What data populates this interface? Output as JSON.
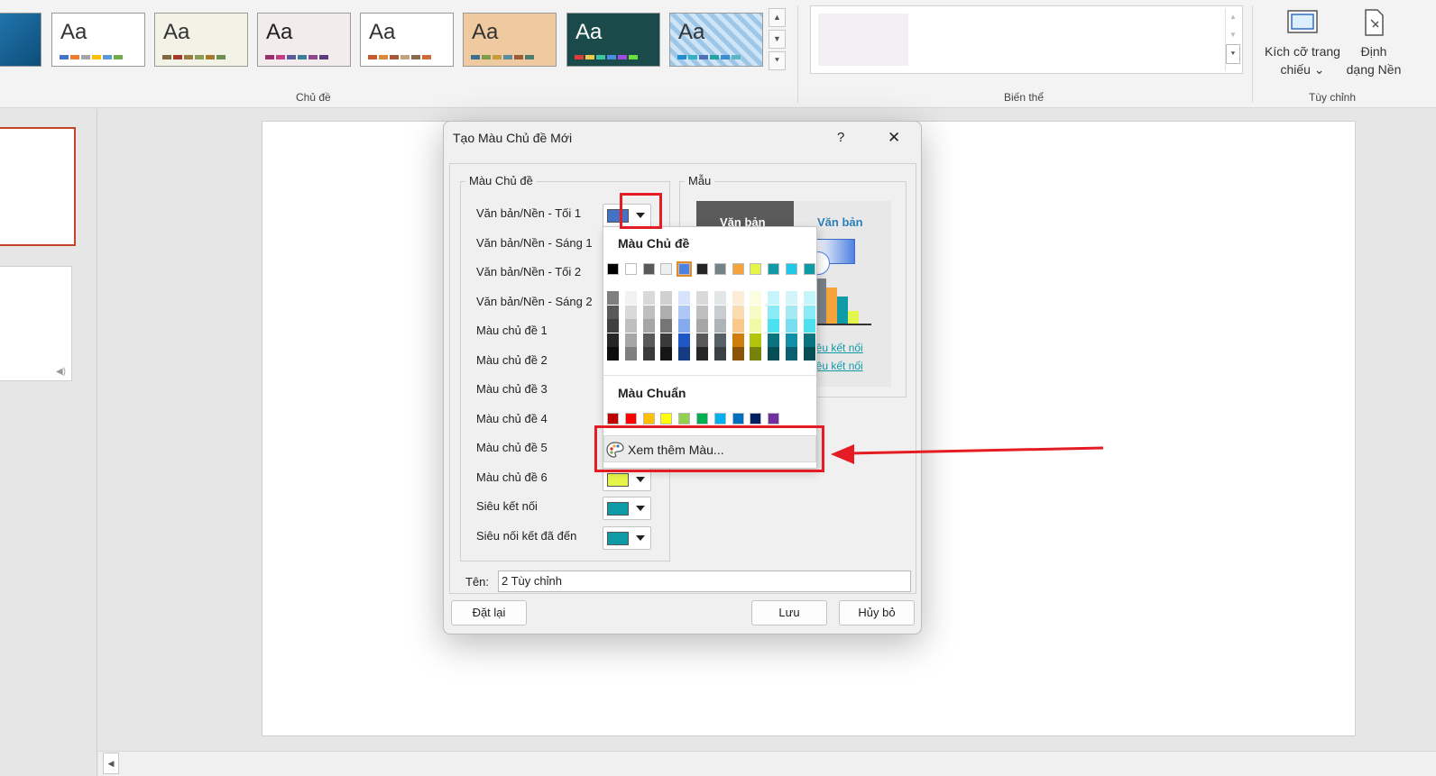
{
  "ribbon": {
    "groups": {
      "themes": "Chủ đề",
      "variants": "Biến thể",
      "customize": "Tùy chỉnh"
    },
    "themes": [
      {
        "aa": "",
        "bg": "#1f6fa3",
        "aa_color": "#fff",
        "bars": []
      },
      {
        "aa": "Aa",
        "bg": "#ffffff",
        "aa_color": "#333333",
        "bars": [
          "#4472c4",
          "#ed7d31",
          "#a5a5a5",
          "#ffc000",
          "#5b9bd5",
          "#70ad47"
        ]
      },
      {
        "aa": "Aa",
        "bg": "#f2f3e6",
        "aa_color": "#333333",
        "bars": [
          "#7f6a3e",
          "#a33a2b",
          "#9b7b3d",
          "#8a9b55",
          "#a67a2d",
          "#6a8f4f"
        ]
      },
      {
        "aa": "Aa",
        "bg": "#f3ecec",
        "aa_color": "#222222",
        "bars": [
          "#9b2f6e",
          "#c43c83",
          "#5a5a9c",
          "#3c7c9c",
          "#8c4a8c",
          "#5c3c7c"
        ]
      },
      {
        "aa": "Aa",
        "bg": "#ffffff",
        "aa_color": "#333333",
        "bars": [
          "#c55a2b",
          "#d98a3a",
          "#a8553c",
          "#c4a27a",
          "#8a6a4a",
          "#d06a3a"
        ]
      },
      {
        "aa": "Aa",
        "bg": "#efc9a0",
        "aa_color": "#333333",
        "bars": [
          "#3c6e8f",
          "#7c9c4c",
          "#c49c3c",
          "#5c8ca0",
          "#9c5c3c",
          "#4c7c6c"
        ]
      },
      {
        "aa": "Aa",
        "bg": "#1b4a4a",
        "aa_color": "#ffffff",
        "bars": [
          "#e03c3c",
          "#ecc94b",
          "#3cc4a0",
          "#4b8ce0",
          "#a04be0",
          "#6ae03c"
        ]
      },
      {
        "aa": "Aa",
        "bg": "#dfe9f3",
        "aa_color": "#333333",
        "bars": [
          "#1f8fcf",
          "#35b0c4",
          "#4c6fb8",
          "#22a4a0",
          "#3c8cd0",
          "#5cb4c4"
        ]
      }
    ],
    "slide_size": {
      "line1": "Kích cỡ trang",
      "line2": "chiếu ⌄",
      "icon": "slide-size-icon"
    },
    "format_bg": {
      "line1": "Định",
      "line2": "dạng Nền",
      "icon": "format-background-icon"
    }
  },
  "dialog": {
    "title": "Tạo Màu Chủ đề Mới",
    "help": "?",
    "close": "✕",
    "theme_colors_group": "Màu Chủ đề",
    "sample_group": "Mẫu",
    "rows": [
      {
        "label": "Văn bản/Nền - Tối 1",
        "color": "#4472c4"
      },
      {
        "label": "Văn bản/Nền - Sáng 1",
        "color": ""
      },
      {
        "label": "Văn bản/Nền - Tối 2",
        "color": ""
      },
      {
        "label": "Văn bản/Nền - Sáng 2",
        "color": ""
      },
      {
        "label": "Màu chủ đề 1",
        "color": ""
      },
      {
        "label": "Màu chủ đề 2",
        "color": ""
      },
      {
        "label": "Màu chủ đề 3",
        "color": ""
      },
      {
        "label": "Màu chủ đề 4",
        "color": ""
      },
      {
        "label": "Màu chủ đề 5",
        "color": ""
      },
      {
        "label": "Màu chủ đề 6",
        "color": "#e6f54a"
      },
      {
        "label": "Siêu kết nối",
        "color": "#0f9aa8"
      },
      {
        "label": "Siêu nối kết đã đến",
        "color": "#0f9aa8"
      }
    ],
    "sample": {
      "dark_text": "Văn bản",
      "light_text": "Văn bản",
      "link1": "Siêu kết nối",
      "link2": "Siêu kết nối"
    },
    "name_label": "Tên:",
    "name_value": "2 Tùy chỉnh",
    "reset": "Đặt lại",
    "save": "Lưu",
    "cancel": "Hủy bỏ"
  },
  "color_popup": {
    "theme_heading": "Màu Chủ đề",
    "theme_colors": [
      "#000000",
      "#ffffff",
      "#595959",
      "#eeeeee",
      "#4f81e0",
      "#252525",
      "#778288",
      "#f5a43c",
      "#e6f54a",
      "#0f9aa8",
      "#1ec8e6",
      "#0f9aa8"
    ],
    "shades": [
      [
        "#7f7f7f",
        "#595959",
        "#404040",
        "#262626",
        "#0d0d0d"
      ],
      [
        "#f2f2f2",
        "#d9d9d9",
        "#bfbfbf",
        "#a6a6a6",
        "#7f7f7f"
      ],
      [
        "#d9d9d9",
        "#bfbfbf",
        "#a6a6a6",
        "#595959",
        "#3a3a3a"
      ],
      [
        "#d0d0d0",
        "#aeaeae",
        "#757575",
        "#3a3a3a",
        "#161616"
      ],
      [
        "#d6e3fa",
        "#aec7f5",
        "#84abef",
        "#1f58c4",
        "#153b82"
      ],
      [
        "#d9d9d9",
        "#bfbfbf",
        "#a6a6a6",
        "#595959",
        "#262626"
      ],
      [
        "#e3e6e7",
        "#c8cdd0",
        "#adb4b8",
        "#566167",
        "#3a4145"
      ],
      [
        "#fdedd8",
        "#fbdbb1",
        "#f9c88a",
        "#d07d0c",
        "#8a5308"
      ],
      [
        "#fafde0",
        "#f5fbc2",
        "#f0f9a4",
        "#b2c40c",
        "#778308"
      ],
      [
        "#c3f5fa",
        "#88ebf5",
        "#4ce1f0",
        "#0b7380",
        "#074d55"
      ],
      [
        "#d2f4fa",
        "#a5e9f5",
        "#78def0",
        "#118fa6",
        "#0b5f6f"
      ],
      [
        "#c3f5fa",
        "#88ebf5",
        "#4ce1f0",
        "#0b7380",
        "#074d55"
      ]
    ],
    "standard_heading": "Màu Chuẩn",
    "standard_colors": [
      "#c00000",
      "#ff0000",
      "#ffc000",
      "#ffff00",
      "#92d050",
      "#00b050",
      "#00b0f0",
      "#0070c0",
      "#002060",
      "#7030a0"
    ],
    "more_colors": "Xem thêm Màu...",
    "more_icon": "palette-icon"
  },
  "annotation": {
    "color": "#e51c23"
  }
}
